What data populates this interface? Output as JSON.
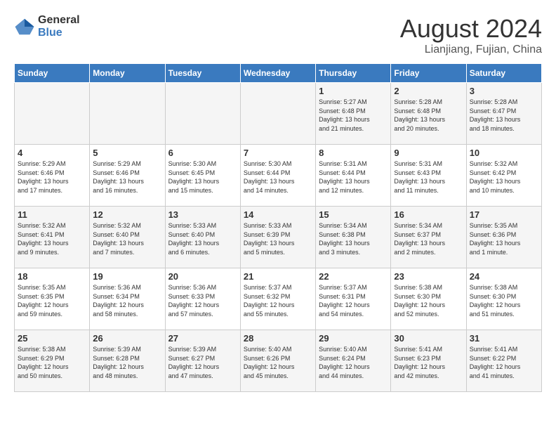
{
  "header": {
    "logo_general": "General",
    "logo_blue": "Blue",
    "title": "August 2024",
    "subtitle": "Lianjiang, Fujian, China"
  },
  "weekdays": [
    "Sunday",
    "Monday",
    "Tuesday",
    "Wednesday",
    "Thursday",
    "Friday",
    "Saturday"
  ],
  "weeks": [
    [
      {
        "day": "",
        "info": ""
      },
      {
        "day": "",
        "info": ""
      },
      {
        "day": "",
        "info": ""
      },
      {
        "day": "",
        "info": ""
      },
      {
        "day": "1",
        "info": "Sunrise: 5:27 AM\nSunset: 6:48 PM\nDaylight: 13 hours\nand 21 minutes."
      },
      {
        "day": "2",
        "info": "Sunrise: 5:28 AM\nSunset: 6:48 PM\nDaylight: 13 hours\nand 20 minutes."
      },
      {
        "day": "3",
        "info": "Sunrise: 5:28 AM\nSunset: 6:47 PM\nDaylight: 13 hours\nand 18 minutes."
      }
    ],
    [
      {
        "day": "4",
        "info": "Sunrise: 5:29 AM\nSunset: 6:46 PM\nDaylight: 13 hours\nand 17 minutes."
      },
      {
        "day": "5",
        "info": "Sunrise: 5:29 AM\nSunset: 6:46 PM\nDaylight: 13 hours\nand 16 minutes."
      },
      {
        "day": "6",
        "info": "Sunrise: 5:30 AM\nSunset: 6:45 PM\nDaylight: 13 hours\nand 15 minutes."
      },
      {
        "day": "7",
        "info": "Sunrise: 5:30 AM\nSunset: 6:44 PM\nDaylight: 13 hours\nand 14 minutes."
      },
      {
        "day": "8",
        "info": "Sunrise: 5:31 AM\nSunset: 6:44 PM\nDaylight: 13 hours\nand 12 minutes."
      },
      {
        "day": "9",
        "info": "Sunrise: 5:31 AM\nSunset: 6:43 PM\nDaylight: 13 hours\nand 11 minutes."
      },
      {
        "day": "10",
        "info": "Sunrise: 5:32 AM\nSunset: 6:42 PM\nDaylight: 13 hours\nand 10 minutes."
      }
    ],
    [
      {
        "day": "11",
        "info": "Sunrise: 5:32 AM\nSunset: 6:41 PM\nDaylight: 13 hours\nand 9 minutes."
      },
      {
        "day": "12",
        "info": "Sunrise: 5:32 AM\nSunset: 6:40 PM\nDaylight: 13 hours\nand 7 minutes."
      },
      {
        "day": "13",
        "info": "Sunrise: 5:33 AM\nSunset: 6:40 PM\nDaylight: 13 hours\nand 6 minutes."
      },
      {
        "day": "14",
        "info": "Sunrise: 5:33 AM\nSunset: 6:39 PM\nDaylight: 13 hours\nand 5 minutes."
      },
      {
        "day": "15",
        "info": "Sunrise: 5:34 AM\nSunset: 6:38 PM\nDaylight: 13 hours\nand 3 minutes."
      },
      {
        "day": "16",
        "info": "Sunrise: 5:34 AM\nSunset: 6:37 PM\nDaylight: 13 hours\nand 2 minutes."
      },
      {
        "day": "17",
        "info": "Sunrise: 5:35 AM\nSunset: 6:36 PM\nDaylight: 13 hours\nand 1 minute."
      }
    ],
    [
      {
        "day": "18",
        "info": "Sunrise: 5:35 AM\nSunset: 6:35 PM\nDaylight: 12 hours\nand 59 minutes."
      },
      {
        "day": "19",
        "info": "Sunrise: 5:36 AM\nSunset: 6:34 PM\nDaylight: 12 hours\nand 58 minutes."
      },
      {
        "day": "20",
        "info": "Sunrise: 5:36 AM\nSunset: 6:33 PM\nDaylight: 12 hours\nand 57 minutes."
      },
      {
        "day": "21",
        "info": "Sunrise: 5:37 AM\nSunset: 6:32 PM\nDaylight: 12 hours\nand 55 minutes."
      },
      {
        "day": "22",
        "info": "Sunrise: 5:37 AM\nSunset: 6:31 PM\nDaylight: 12 hours\nand 54 minutes."
      },
      {
        "day": "23",
        "info": "Sunrise: 5:38 AM\nSunset: 6:30 PM\nDaylight: 12 hours\nand 52 minutes."
      },
      {
        "day": "24",
        "info": "Sunrise: 5:38 AM\nSunset: 6:30 PM\nDaylight: 12 hours\nand 51 minutes."
      }
    ],
    [
      {
        "day": "25",
        "info": "Sunrise: 5:38 AM\nSunset: 6:29 PM\nDaylight: 12 hours\nand 50 minutes."
      },
      {
        "day": "26",
        "info": "Sunrise: 5:39 AM\nSunset: 6:28 PM\nDaylight: 12 hours\nand 48 minutes."
      },
      {
        "day": "27",
        "info": "Sunrise: 5:39 AM\nSunset: 6:27 PM\nDaylight: 12 hours\nand 47 minutes."
      },
      {
        "day": "28",
        "info": "Sunrise: 5:40 AM\nSunset: 6:26 PM\nDaylight: 12 hours\nand 45 minutes."
      },
      {
        "day": "29",
        "info": "Sunrise: 5:40 AM\nSunset: 6:24 PM\nDaylight: 12 hours\nand 44 minutes."
      },
      {
        "day": "30",
        "info": "Sunrise: 5:41 AM\nSunset: 6:23 PM\nDaylight: 12 hours\nand 42 minutes."
      },
      {
        "day": "31",
        "info": "Sunrise: 5:41 AM\nSunset: 6:22 PM\nDaylight: 12 hours\nand 41 minutes."
      }
    ]
  ]
}
